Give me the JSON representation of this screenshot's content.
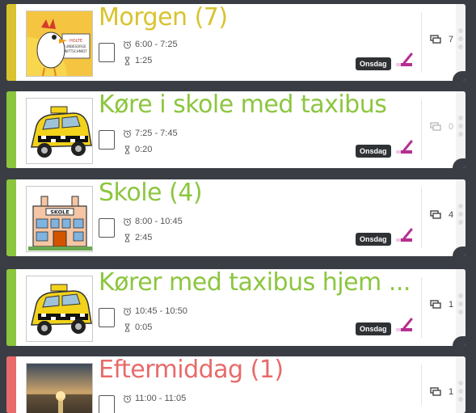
{
  "colors": {
    "green": "#8cc63f",
    "yellow": "#d9c32e",
    "red": "#e86a6a",
    "purple": "#b5308f"
  },
  "activities": [
    {
      "title": "Morgen (7)",
      "time": "6:00 - 7:25",
      "duration": "1:25",
      "day": "Onsdag",
      "count": "7",
      "stripe": "yellow",
      "title_color": "yellow",
      "image": "rooster-image"
    },
    {
      "title": "Køre i skole med taxibus",
      "time": "7:25 - 7:45",
      "duration": "0:20",
      "day": "Onsdag",
      "count": "0",
      "stripe": "green",
      "title_color": "green",
      "image": "taxi-image"
    },
    {
      "title": "Skole (4)",
      "time": "8:00 - 10:45",
      "duration": "2:45",
      "day": "Onsdag",
      "count": "4",
      "stripe": "green",
      "title_color": "green",
      "image": "school-image"
    },
    {
      "title": "Kører med taxibus hjem ...",
      "time": "10:45 - 10:50",
      "duration": "0:05",
      "day": "Onsdag",
      "count": "1",
      "stripe": "green",
      "title_color": "green",
      "image": "taxi-image"
    },
    {
      "title": "Eftermiddag (1)",
      "time": "11:00 - 11:05",
      "duration": "",
      "day": "",
      "count": "1",
      "stripe": "red",
      "title_color": "red",
      "image": "sunset-image"
    }
  ]
}
